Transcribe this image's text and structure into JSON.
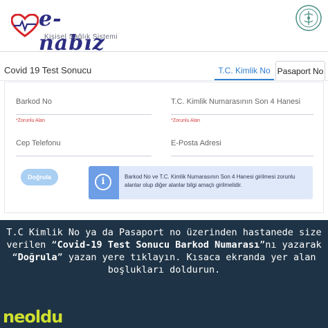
{
  "header": {
    "logo_text": "e-nabız",
    "logo_subtitle": "Kişisel Sağlık Sistemi"
  },
  "panel": {
    "title": "Covid 19 Test Sonucu",
    "tabs": [
      {
        "label": "T.C. Kimlik No",
        "active": true
      },
      {
        "label": "Pasaport No",
        "active": false
      }
    ]
  },
  "form": {
    "barcode_label": "Barkod No",
    "barcode_required": "*Zorunlu Alan",
    "tc_label": "T.C. Kimlik Numarasının Son 4 Hanesi",
    "tc_required": "*Zorunlu Alan",
    "phone_label": "Cep Telefonu",
    "email_label": "E-Posta Adresi",
    "submit_label": "Doğrula"
  },
  "info": {
    "icon": "info-icon",
    "text": "Barkod No ve T.C. Kimlik Numarasının Son 4 Hanesi girilmesi zorunlu alanlar olup diğer alanlar bilgi amaçlı girilmelidir."
  },
  "caption": {
    "part1": "T.C Kimlik No ya da Pasaport no üzerinden hastanede size verilen “",
    "bold1": "Covid-19 Test Sonucu Barkod Numarası",
    "part2": "”nı yazarak “",
    "bold2": "Doğrula",
    "part3": "” yazan yere tıklayın. Kısaca ekranda yer alan boşlukları doldurun."
  },
  "brand": "neoldu",
  "colors": {
    "accent": "#2f7fd0",
    "button": "#a9cff2",
    "info_bg": "#dfe9f9",
    "info_bar": "#6d9ee6",
    "banner": "#1e3345",
    "brand": "#cfe02f",
    "required": "#d33c3c"
  }
}
